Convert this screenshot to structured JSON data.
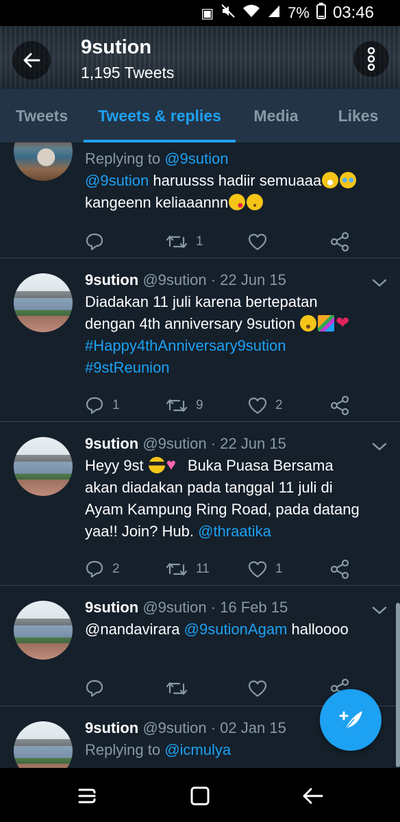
{
  "status_bar": {
    "battery": "7%",
    "time": "03:46"
  },
  "header": {
    "title": "9sution",
    "tweet_count": "1,195 Tweets"
  },
  "tabs": [
    {
      "label": "Tweets",
      "active": false
    },
    {
      "label": "Tweets & replies",
      "active": true
    },
    {
      "label": "Media",
      "active": false
    },
    {
      "label": "Likes",
      "active": false
    }
  ],
  "tweets": [
    {
      "replying_label": "Replying to",
      "replying_handle": "@9sution",
      "text_mention": "@9sution",
      "text_1": " haruusss hadiir semuaaa",
      "text_2": "kangeenn keliaaannn",
      "actions": {
        "reply": "",
        "retweet": "1",
        "like": ""
      }
    },
    {
      "name": "9sution",
      "meta": " @9sution · 22 Jun 15",
      "text_1": "Diadakan 11 juli karena bertepatan",
      "text_2": "dengan 4th anniversary 9sution ",
      "hashtag_1": "#Happy4thAnniversary9sution",
      "hashtag_2": "#9stReunion",
      "actions": {
        "reply": "1",
        "retweet": "9",
        "like": "2"
      }
    },
    {
      "name": "9sution",
      "meta": " @9sution · 22 Jun 15",
      "text_1": "Heyy 9st ",
      "text_1b": " Buka Puasa Bersama",
      "text_2": "akan diadakan pada tanggal 11 juli di",
      "text_3": "Ayam Kampung Ring Road, pada datang",
      "text_4": "yaa!! Join? Hub. ",
      "mention": "@thraatika",
      "actions": {
        "reply": "2",
        "retweet": "11",
        "like": "1"
      }
    },
    {
      "name": "9sution",
      "meta": " @9sution · 16 Feb 15",
      "text_plain": "@nandavirara ",
      "mention": "@9sutionAgam",
      "text_after": " halloooo",
      "actions": {
        "reply": "",
        "retweet": "",
        "like": ""
      }
    },
    {
      "name": "9sution",
      "meta": " @9sution · 02 Jan 15",
      "replying_label": "Replying to",
      "replying_handle": "@icmulya"
    }
  ],
  "colors": {
    "background": "#15202b",
    "tabs": "#243447",
    "accent": "#1da1f2",
    "muted": "#8899a6"
  }
}
